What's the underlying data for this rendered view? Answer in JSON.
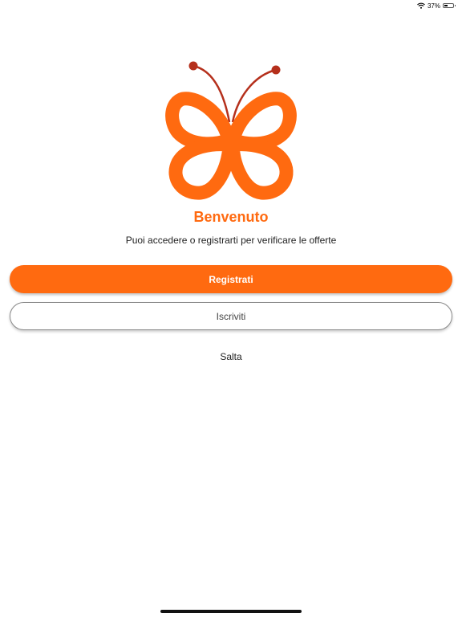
{
  "status_bar": {
    "battery_text": "37%",
    "battery_level": 0.37
  },
  "welcome": {
    "title": "Benvenuto",
    "subtitle": "Puoi accedere o registrarti per verificare le offerte"
  },
  "actions": {
    "register_label": "Registrati",
    "signup_label": "Iscriviti",
    "skip_label": "Salta"
  },
  "icons": {
    "logo": "butterfly-logo-icon",
    "wifi": "wifi-icon",
    "battery": "battery-icon"
  },
  "colors": {
    "accent": "#ff6a10",
    "antenna": "#b5301c",
    "primary_text": "#ffffff",
    "secondary_text": "#444444"
  }
}
